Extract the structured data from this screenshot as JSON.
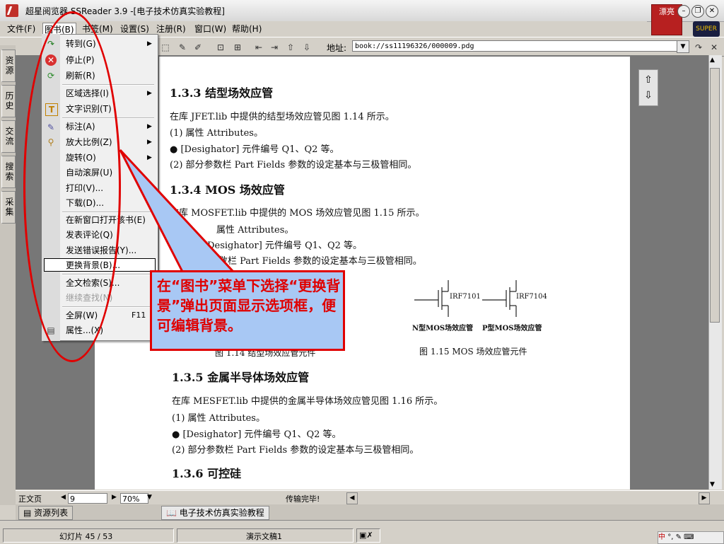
{
  "window": {
    "title": "超星阅览器 SSReader 3.9 -[电子技术仿真实验教程]",
    "deco_badge": "漂亮",
    "globe_badge": "SUPER",
    "minimize": "–",
    "restore": "❐",
    "close": "✕"
  },
  "menubar": [
    "文件(F)",
    "图书(B)",
    "书签(M)",
    "设置(S)",
    "注册(R)",
    "窗口(W)",
    "帮助(H)"
  ],
  "toolbar": {
    "address_label": "地址:",
    "address_value": "book://ss11196326/000009.pdg"
  },
  "side_tabs": [
    "资源",
    "历史",
    "交流",
    "搜索",
    "采集"
  ],
  "menu": {
    "items": [
      {
        "label": "转到(G)",
        "submenu": true,
        "icon": "redo-icon"
      },
      {
        "label": "停止(P)",
        "icon": "stop-icon"
      },
      {
        "label": "刷新(R)",
        "icon": "refresh-icon"
      },
      {
        "label": "区域选择(I)",
        "submenu": true
      },
      {
        "label": "文字识别(T)",
        "icon": "text-recognition-icon"
      },
      {
        "label": "标注(A)",
        "submenu": true,
        "icon": "annotate-icon"
      },
      {
        "label": "放大比例(Z)",
        "submenu": true,
        "icon": "magnifier-icon"
      },
      {
        "label": "旋转(O)",
        "submenu": true
      },
      {
        "label": "自动滚屏(U)"
      },
      {
        "label": "打印(V)..."
      },
      {
        "label": "下载(D)..."
      },
      {
        "label": "在新窗口打开该书(E)"
      },
      {
        "label": "发表评论(Q)"
      },
      {
        "label": "发送错误报告(Y)..."
      },
      {
        "label": "更换背景(B)...",
        "selected": true
      },
      {
        "label": "全文检索(S)..."
      },
      {
        "label": "继续查找(N)",
        "disabled": true
      },
      {
        "label": "全屏(W)",
        "shortcut": "F11"
      },
      {
        "label": "属性...(X)",
        "icon": "properties-icon"
      }
    ]
  },
  "callout": {
    "text": "在“图书”菜单下选择“更换背景”弹出页面显示选项框，便可编辑背景。"
  },
  "document": {
    "h133": "1.3.3   结型场效应管",
    "p1": "在库 JFET.lib 中提供的结型场效应管见图 1.14 所示。",
    "p2": "(1) 属性 Attributes。",
    "p3": "●    [Desighator]  元件编号 Q1、Q2 等。",
    "p4": "(2) 部分参数栏 Part Fields 参数的设定基本与三极管相同。",
    "h134": "1.3.4   MOS 场效应管",
    "p5": "在库 MOSFET.lib 中提供的 MOS 场效应管见图 1.15 所示。",
    "p6": "属性 Attributes。",
    "p7": "[Desighator]  元件编号 Q1、Q2 等。",
    "p8": "参数栏  Part Fields 参数的设定基本与三极管相同。",
    "fet1_label": "IRF7101",
    "fet2_label": "IRF7104",
    "fet1_cap": "N型MOS场效应管",
    "fet2_cap": "P型MOS场效应管",
    "fig114": "图 1.14   结型场效应管元件",
    "fig115": "图 1.15   MOS 场效应管元件",
    "h135": "1.3.5   金属半导体场效应管",
    "p9": "在库 MESFET.lib 中提供的金属半导体场效应管见图 1.16 所示。",
    "p10": "(1) 属性 Attributes。",
    "p11": "●    [Desighator]  元件编号 Q1、Q2 等。",
    "p12": "(2) 部分参数栏 Part Fields 参数的设定基本与三极管相同。",
    "h136": "1.3.6   可控硅"
  },
  "doc_status": {
    "view_mode": "正文页",
    "page": "9",
    "zoom": "70%",
    "transfer": "传输完毕!"
  },
  "bottom_tabs": [
    "资源列表",
    "电子技术仿真实验教程"
  ],
  "app_status": {
    "slide": "幻灯片 45 / 53",
    "deck": "演示文稿1"
  },
  "colors": {
    "annotation_red": "#e00000",
    "callout_fill": "#a8c8f4"
  }
}
